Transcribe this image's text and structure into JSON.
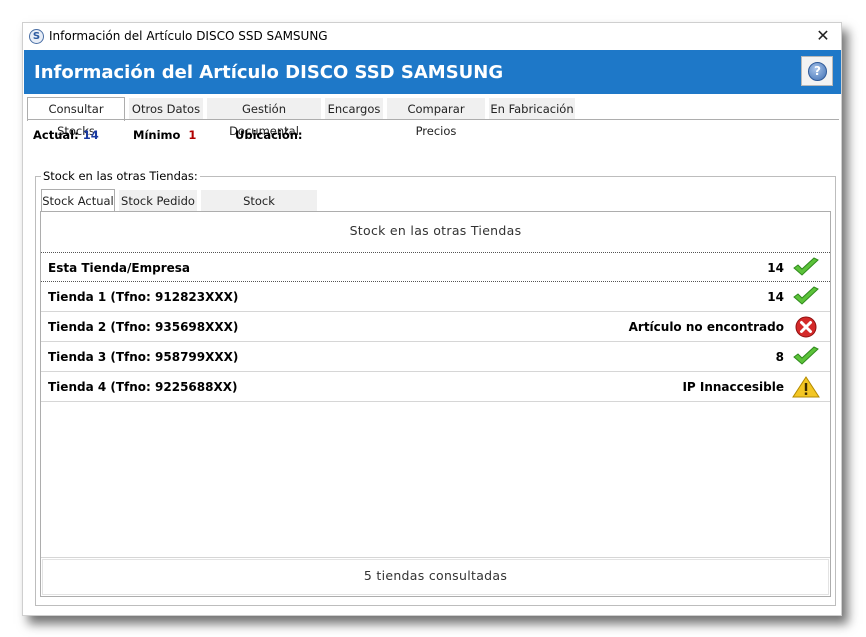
{
  "window": {
    "title": "Información del Artículo DISCO SSD SAMSUNG",
    "close_glyph": "✕",
    "app_icon_letter": "S"
  },
  "header": {
    "title": "Información del Artículo DISCO SSD SAMSUNG",
    "help_glyph": "?"
  },
  "tabs": [
    {
      "label": "Consultar Stocks",
      "active": true
    },
    {
      "label": "Otros Datos",
      "active": false
    },
    {
      "label": "Gestión Documental",
      "active": false
    },
    {
      "label": "Encargos",
      "active": false
    },
    {
      "label": "Comparar Precios",
      "active": false
    },
    {
      "label": "En Fabricación",
      "active": false
    }
  ],
  "info": {
    "actual_label": "Actual:",
    "actual_value": "14",
    "minimo_label": "Mínimo",
    "minimo_value": "1",
    "ubicacion_label": "Ubicación:",
    "ubicacion_value": ""
  },
  "stock_group": {
    "label": "Stock en las otras Tiendas:",
    "subtabs": [
      {
        "label": "Stock Actual",
        "active": true
      },
      {
        "label": "Stock Pedido",
        "active": false
      },
      {
        "label": "Stock Presupuestado",
        "active": false
      }
    ],
    "panel_title": "Stock  en  las  otras  Tiendas",
    "rows": [
      {
        "name": "Esta Tienda/Empresa",
        "value": "14",
        "status": "check-icon"
      },
      {
        "name": "Tienda 1 (Tfno: 912823XXX)",
        "value": "14",
        "status": "check-icon"
      },
      {
        "name": "Tienda 2 (Tfno: 935698XXX)",
        "value": "Artículo no encontrado",
        "status": "error-icon"
      },
      {
        "name": "Tienda 3 (Tfno: 958799XXX)",
        "value": "8",
        "status": "check-icon"
      },
      {
        "name": "Tienda 4 (Tfno: 9225688XX)",
        "value": "IP Innaccesible",
        "status": "warning-icon"
      }
    ],
    "footer": "5  tiendas  consultadas"
  },
  "colors": {
    "header_bg": "#1e78c8",
    "check_green": "#5cc23a",
    "error_red": "#d42a2a",
    "warning_yellow": "#f3c623"
  }
}
